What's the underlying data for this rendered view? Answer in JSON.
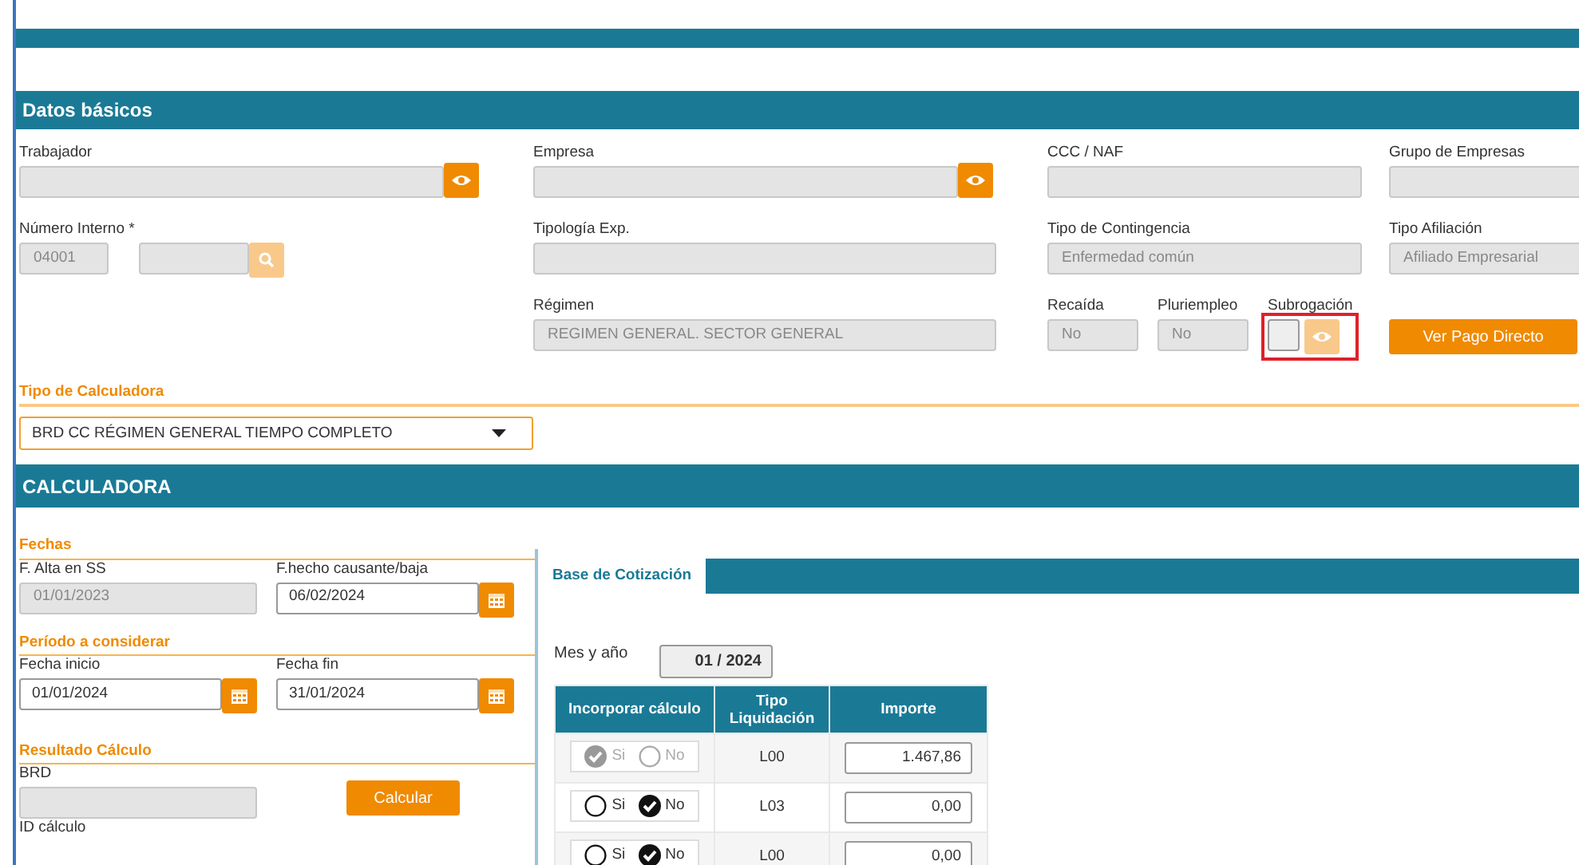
{
  "section_title": "Datos básicos",
  "rows": [
    {
      "cells": [
        [
          {
            "kind": "eye",
            "label": "Trabajador",
            "eye_disabled": false
          }
        ],
        [
          {
            "kind": "eye",
            "label": "Empresa",
            "eye_disabled": false
          }
        ],
        [
          {
            "kind": "text",
            "label": "CCC / NAF"
          }
        ],
        [
          {
            "kind": "text",
            "label": "Grupo de Empresas"
          }
        ]
      ]
    },
    {
      "cells": [
        [
          {
            "kind": "search_pair",
            "label": "Número Interno *",
            "value": "04001"
          }
        ],
        [
          {
            "kind": "text",
            "label": "Tipología Exp."
          }
        ],
        [
          {
            "kind": "text",
            "label": "Tipo de Contingencia",
            "value": "Enfermedad común"
          }
        ],
        [
          {
            "kind": "text",
            "label": "Tipo Afiliación",
            "value": "Afiliado Empresarial"
          }
        ]
      ]
    },
    {
      "cells": [
        [],
        [
          {
            "kind": "text",
            "label": "Régimen",
            "value": "REGIMEN GENERAL. SECTOR GENERAL"
          }
        ],
        [
          {
            "kind": "small",
            "label": "Recaída",
            "value": "No"
          },
          {
            "kind": "small",
            "label": "Pluriempleo",
            "value": "No"
          },
          {
            "kind": "check_eye",
            "label": "Subrogación",
            "checked": false,
            "eye_disabled": true,
            "highlighted": true
          }
        ],
        [
          {
            "kind": "button",
            "label": "Ver Pago Directo"
          }
        ]
      ]
    }
  ],
  "calculator_type": {
    "title": "Tipo de Calculadora",
    "value": "BRD CC RÉGIMEN GENERAL TIEMPO COMPLETO"
  },
  "calculator_title": "CALCULADORA",
  "groups": [
    {
      "title": "Fechas",
      "fields": [
        {
          "kind": "date",
          "label": "F. Alta en SS",
          "value": "01/01/2023",
          "disabled": true
        },
        {
          "kind": "date",
          "label": "F.hecho causante/baja",
          "value": "06/02/2024",
          "disabled": false
        }
      ]
    },
    {
      "title": "Período a considerar",
      "fields": [
        {
          "kind": "date",
          "label": "Fecha inicio",
          "value": "01/01/2024",
          "disabled": false
        },
        {
          "kind": "date",
          "label": "Fecha fin",
          "value": "31/01/2024",
          "disabled": false
        }
      ]
    },
    {
      "title": "Resultado Cálculo",
      "fields": [
        {
          "kind": "text",
          "label": "BRD",
          "disabled": true
        },
        {
          "kind": "button",
          "label": "Calcular"
        },
        {
          "kind": "label",
          "label": "ID cálculo"
        }
      ]
    }
  ],
  "tabs": [
    {
      "label": "Base de Cotización",
      "selected": true
    }
  ],
  "month": {
    "label": "Mes y año",
    "value": "01 / 2024"
  },
  "table": {
    "columns": [
      "Incorporar cálculo",
      "Tipo Liquidación",
      "Importe"
    ],
    "rows": [
      {
        "disabled": true,
        "options": [
          {
            "label": "Si",
            "selected": true
          },
          {
            "label": "No",
            "selected": false
          }
        ],
        "tipo": "L00",
        "importe": "1.467,86"
      },
      {
        "disabled": false,
        "options": [
          {
            "label": "Si",
            "selected": false
          },
          {
            "label": "No",
            "selected": true
          }
        ],
        "tipo": "L03",
        "importe": "0,00"
      },
      {
        "disabled": false,
        "options": [
          {
            "label": "Si",
            "selected": false
          },
          {
            "label": "No",
            "selected": true
          }
        ],
        "tipo": "L00",
        "importe": "0,00"
      }
    ]
  }
}
